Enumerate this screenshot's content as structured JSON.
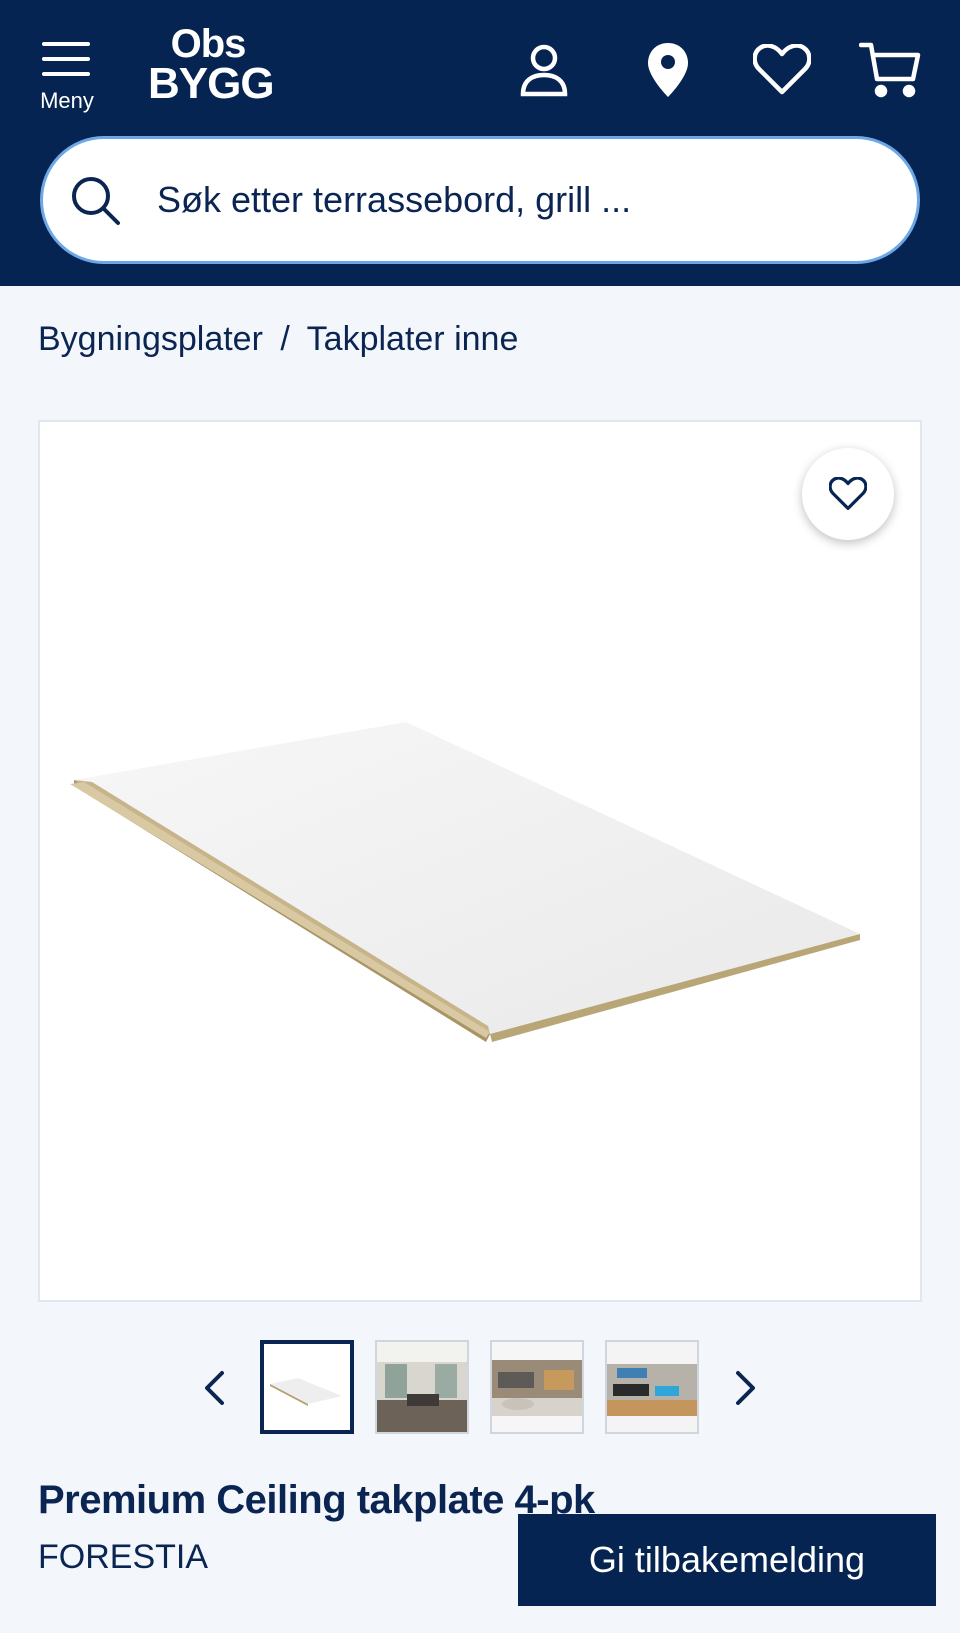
{
  "header": {
    "menu_label": "Meny",
    "logo_top": "Obs",
    "logo_bottom": "BYGG",
    "icons": [
      "user-icon",
      "location-pin-icon",
      "heart-icon",
      "cart-icon"
    ]
  },
  "search": {
    "placeholder": "Søk etter terrassebord, grill ..."
  },
  "breadcrumb": {
    "items": [
      "Bygningsplater",
      "Takplater inne"
    ],
    "separator": "/"
  },
  "product": {
    "title": "Premium Ceiling takplate 4-pk",
    "brand": "FORESTIA",
    "thumbnail_count": 4,
    "active_thumbnail": 1
  },
  "feedback_button": {
    "label": "Gi tilbakemelding"
  },
  "colors": {
    "header_bg": "#062451",
    "accent_border": "#6fa7e6",
    "text_primary": "#0b2553",
    "page_bg": "#f3f6fa"
  }
}
